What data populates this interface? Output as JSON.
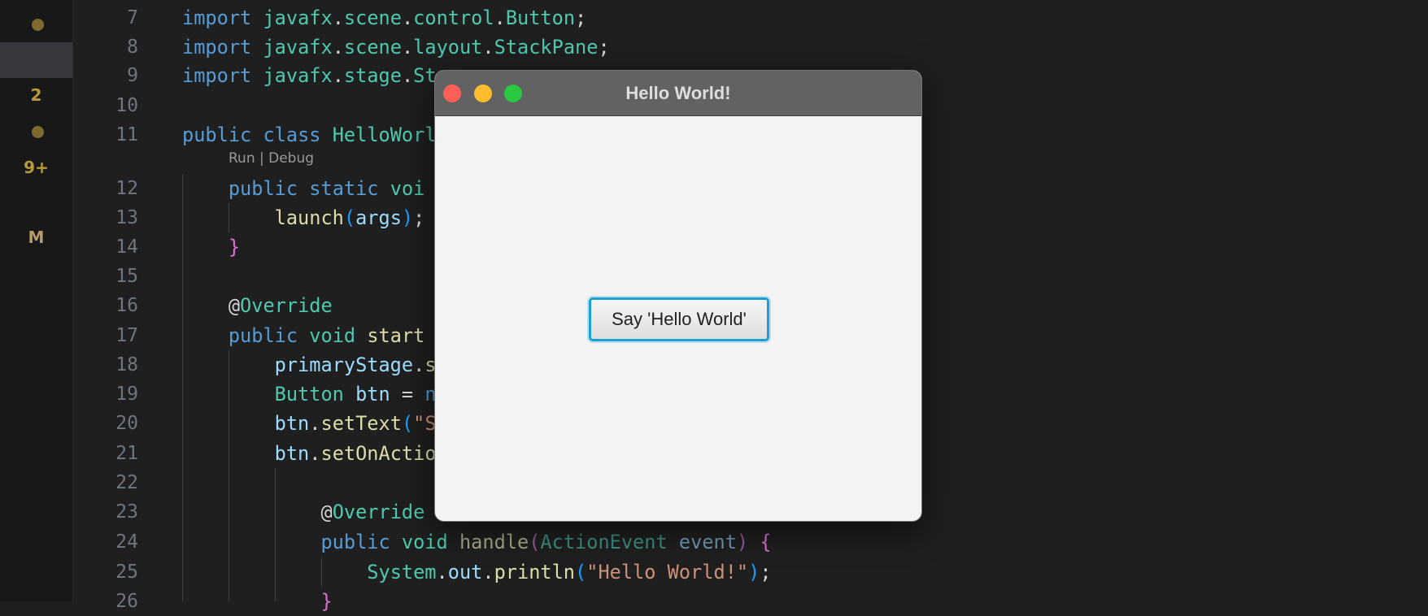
{
  "activity_bar": {
    "badges": [
      "2",
      "9+",
      "M"
    ],
    "badge_color": "#b89a3a"
  },
  "editor": {
    "codelens": "Run | Debug",
    "lines": [
      {
        "num": "7",
        "tokens": [
          [
            "import",
            "kw"
          ],
          [
            " ",
            "pu"
          ],
          [
            "javafx",
            "ty"
          ],
          [
            ".",
            "pu"
          ],
          [
            "scene",
            "ty"
          ],
          [
            ".",
            "pu"
          ],
          [
            "control",
            "ty"
          ],
          [
            ".",
            "pu"
          ],
          [
            "Button",
            "ty"
          ],
          [
            ";",
            "pu"
          ]
        ]
      },
      {
        "num": "8",
        "tokens": [
          [
            "import",
            "kw"
          ],
          [
            " ",
            "pu"
          ],
          [
            "javafx",
            "ty"
          ],
          [
            ".",
            "pu"
          ],
          [
            "scene",
            "ty"
          ],
          [
            ".",
            "pu"
          ],
          [
            "layout",
            "ty"
          ],
          [
            ".",
            "pu"
          ],
          [
            "StackPane",
            "ty"
          ],
          [
            ";",
            "pu"
          ]
        ]
      },
      {
        "num": "9",
        "tokens": [
          [
            "import",
            "kw"
          ],
          [
            " ",
            "pu"
          ],
          [
            "javafx",
            "ty"
          ],
          [
            ".",
            "pu"
          ],
          [
            "stage",
            "ty"
          ],
          [
            ".",
            "pu"
          ],
          [
            "St",
            "ty"
          ]
        ]
      },
      {
        "num": "10",
        "tokens": []
      },
      {
        "num": "11",
        "tokens": [
          [
            "public",
            "kw"
          ],
          [
            " ",
            "pu"
          ],
          [
            "class",
            "kw"
          ],
          [
            " ",
            "pu"
          ],
          [
            "HelloWorl",
            "ty"
          ]
        ]
      },
      {
        "num": "12",
        "tokens": [
          [
            "    ",
            "pu"
          ],
          [
            "public",
            "kw"
          ],
          [
            " ",
            "pu"
          ],
          [
            "static",
            "kw"
          ],
          [
            " ",
            "pu"
          ],
          [
            "voi",
            "ty"
          ]
        ]
      },
      {
        "num": "13",
        "tokens": [
          [
            "        ",
            "pu"
          ],
          [
            "launch",
            "fn"
          ],
          [
            "(",
            "pa"
          ],
          [
            "args",
            "va"
          ],
          [
            ")",
            "pa"
          ],
          [
            ";",
            "pu"
          ]
        ]
      },
      {
        "num": "14",
        "tokens": [
          [
            "    ",
            "pu"
          ],
          [
            "}",
            "br"
          ]
        ]
      },
      {
        "num": "15",
        "tokens": []
      },
      {
        "num": "16",
        "tokens": [
          [
            "    ",
            "pu"
          ],
          [
            "@",
            "at"
          ],
          [
            "Override",
            "ty"
          ]
        ]
      },
      {
        "num": "17",
        "tokens": [
          [
            "    ",
            "pu"
          ],
          [
            "public",
            "kw"
          ],
          [
            " ",
            "pu"
          ],
          [
            "void",
            "ty"
          ],
          [
            " ",
            "pu"
          ],
          [
            "start",
            "fn"
          ]
        ]
      },
      {
        "num": "18",
        "tokens": [
          [
            "        ",
            "pu"
          ],
          [
            "primaryStage",
            "va"
          ],
          [
            ".",
            "pu"
          ],
          [
            "s",
            "fn"
          ]
        ]
      },
      {
        "num": "19",
        "tokens": [
          [
            "        ",
            "pu"
          ],
          [
            "Button",
            "ty"
          ],
          [
            " ",
            "pu"
          ],
          [
            "btn",
            "va"
          ],
          [
            " = ",
            "pu"
          ],
          [
            "n",
            "kw"
          ]
        ]
      },
      {
        "num": "20",
        "tokens": [
          [
            "        ",
            "pu"
          ],
          [
            "btn",
            "va"
          ],
          [
            ".",
            "pu"
          ],
          [
            "setText",
            "fn"
          ],
          [
            "(",
            "pa"
          ],
          [
            "\"S",
            "st"
          ]
        ]
      },
      {
        "num": "21",
        "tokens": [
          [
            "        ",
            "pu"
          ],
          [
            "btn",
            "va"
          ],
          [
            ".",
            "pu"
          ],
          [
            "setOnActio",
            "fn"
          ]
        ]
      },
      {
        "num": "22",
        "tokens": []
      },
      {
        "num": "23",
        "tokens": [
          [
            "            ",
            "pu"
          ],
          [
            "@",
            "at"
          ],
          [
            "Override",
            "ty"
          ]
        ]
      },
      {
        "num": "24",
        "tokens": [
          [
            "            ",
            "pu"
          ],
          [
            "public",
            "kw"
          ],
          [
            " ",
            "pu"
          ],
          [
            "void",
            "ty"
          ],
          [
            " ",
            "pu"
          ],
          [
            "handle",
            "dfn"
          ],
          [
            "(",
            "dpa"
          ],
          [
            "ActionEvent",
            "dty"
          ],
          [
            " ",
            "pu"
          ],
          [
            "event",
            "dva"
          ],
          [
            ")",
            "dpa"
          ],
          [
            " ",
            "pu"
          ],
          [
            "{",
            "br"
          ]
        ]
      },
      {
        "num": "25",
        "tokens": [
          [
            "                ",
            "pu"
          ],
          [
            "System",
            "ty"
          ],
          [
            ".",
            "pu"
          ],
          [
            "out",
            "va"
          ],
          [
            ".",
            "pu"
          ],
          [
            "println",
            "fn"
          ],
          [
            "(",
            "pa"
          ],
          [
            "\"Hello World!\"",
            "st"
          ],
          [
            ")",
            "pa"
          ],
          [
            ";",
            "pu"
          ]
        ]
      },
      {
        "num": "26",
        "tokens": [
          [
            "            ",
            "pu"
          ],
          [
            "}",
            "br"
          ]
        ]
      }
    ]
  },
  "app_window": {
    "title": "Hello World!",
    "button_label": "Say 'Hello World'",
    "traffic_lights": {
      "close": "#fe5f57",
      "minimize": "#febc2e",
      "zoom": "#28c840"
    },
    "focus_color": "#1d9fd6"
  }
}
